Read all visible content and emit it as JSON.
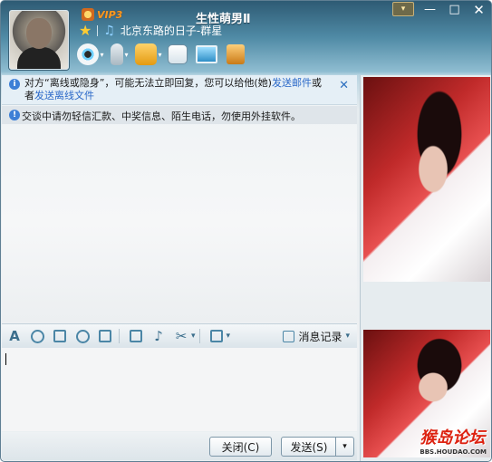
{
  "window": {
    "title": "生性萌男Ⅱ",
    "vip_label": "VIP3",
    "signature": "北京东路的日子-群星",
    "controls": {
      "skin": "▾",
      "minimize": "—",
      "maximize": "□",
      "close": "✕"
    }
  },
  "toolbar": {
    "items": [
      {
        "icon": "webcam-icon"
      },
      {
        "icon": "microphone-icon"
      },
      {
        "icon": "send-file-icon"
      },
      {
        "icon": "app-list-icon"
      },
      {
        "icon": "remote-desktop-icon"
      },
      {
        "icon": "notepad-icon"
      }
    ]
  },
  "notices": {
    "offline_prefix": "对方“离线或隐身”，可能无法立即回复，您可以给他(她)",
    "send_mail_link": "发送邮件",
    "or_text": "或者",
    "offline_file_link": "发送离线文件",
    "safety": "交谈中请勿轻信汇款、中奖信息、陌生电话，勿使用外挂软件。"
  },
  "format_bar": {
    "font_glyph": "A",
    "history_label": "消息记录",
    "dropdown_glyph": "▾"
  },
  "buttons": {
    "close": "关闭(C)",
    "send": "发送(S)",
    "send_dropdown": "▾"
  },
  "watermark": {
    "text": "猴岛论坛",
    "sub": "BBS.HOUDAO.COM"
  }
}
